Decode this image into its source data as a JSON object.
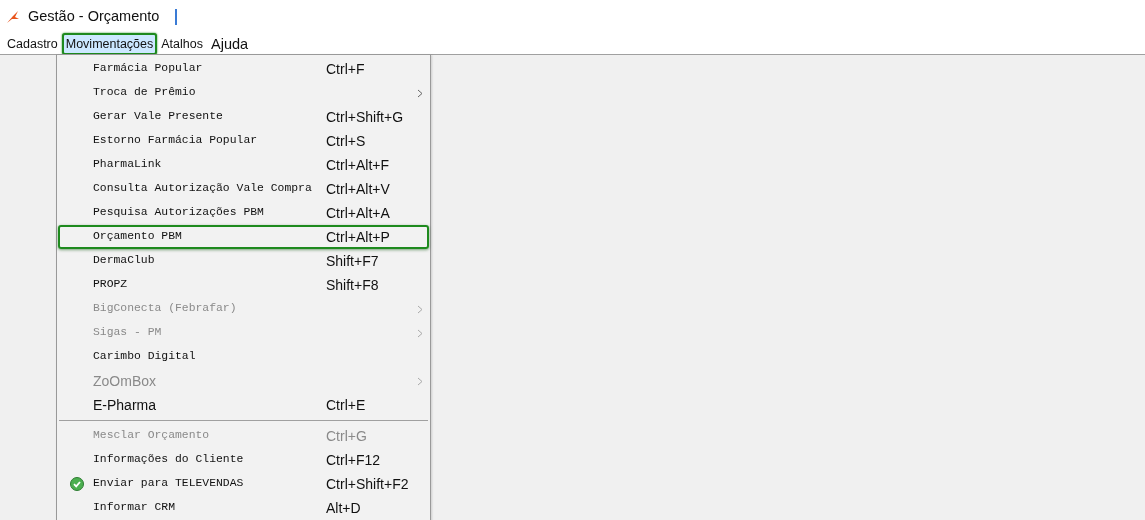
{
  "window": {
    "title": "Gestão - Orçamento"
  },
  "menu_bar": [
    {
      "label": "Cadastro",
      "selected": false
    },
    {
      "label": "Movimentações",
      "selected": true
    },
    {
      "label": "Atalhos",
      "selected": false
    },
    {
      "label": "Ajuda",
      "selected": false
    }
  ],
  "menu": [
    {
      "kind": "mono",
      "label": "Farmácia Popular",
      "shortcut": "Ctrl+F",
      "disabled": false,
      "submenu": false,
      "checked": false,
      "selected": false
    },
    {
      "kind": "mono",
      "label": "Troca de Prêmio",
      "disabled": false,
      "submenu": true,
      "checked": false,
      "selected": false
    },
    {
      "kind": "mono",
      "label": "Gerar Vale Presente",
      "shortcut": "Ctrl+Shift+G",
      "disabled": false,
      "submenu": false,
      "checked": false,
      "selected": false
    },
    {
      "kind": "mono",
      "label": "Estorno Farmácia Popular",
      "shortcut": "Ctrl+S",
      "disabled": false,
      "submenu": false,
      "checked": false,
      "selected": false
    },
    {
      "kind": "mono",
      "label": "PharmaLink",
      "shortcut": "Ctrl+Alt+F",
      "disabled": false,
      "submenu": false,
      "checked": false,
      "selected": false
    },
    {
      "kind": "mono",
      "label": "Consulta Autorização Vale Compra",
      "shortcut": "Ctrl+Alt+V",
      "disabled": false,
      "submenu": false,
      "checked": false,
      "selected": false
    },
    {
      "kind": "mono",
      "label": "Pesquisa Autorizações PBM",
      "shortcut": "Ctrl+Alt+A",
      "disabled": false,
      "submenu": false,
      "checked": false,
      "selected": false
    },
    {
      "kind": "mono",
      "label": "Orçamento PBM",
      "shortcut": "Ctrl+Alt+P",
      "disabled": false,
      "submenu": false,
      "checked": false,
      "selected": true
    },
    {
      "kind": "mono",
      "label": "DermaClub",
      "shortcut": "Shift+F7",
      "disabled": false,
      "submenu": false,
      "checked": false,
      "selected": false
    },
    {
      "kind": "mono",
      "label": "PROPZ",
      "shortcut": "Shift+F8",
      "disabled": false,
      "submenu": false,
      "checked": false,
      "selected": false
    },
    {
      "kind": "mono",
      "label": "BigConecta (Febrafar)",
      "disabled": true,
      "submenu": true,
      "checked": false,
      "selected": false
    },
    {
      "kind": "mono",
      "label": "Sigas - PM",
      "disabled": true,
      "submenu": true,
      "checked": false,
      "selected": false
    },
    {
      "kind": "mono",
      "label": "Carimbo Digital",
      "disabled": false,
      "submenu": false,
      "checked": false,
      "selected": false
    },
    {
      "kind": "sans",
      "label": "ZoOmBox",
      "disabled": true,
      "submenu": true,
      "checked": false,
      "selected": false
    },
    {
      "kind": "sans",
      "label": "E-Pharma",
      "shortcut": "Ctrl+E",
      "disabled": false,
      "submenu": false,
      "checked": false,
      "selected": false
    },
    {
      "kind": "separator"
    },
    {
      "kind": "mono",
      "label": "Mesclar Orçamento",
      "shortcut": "Ctrl+G",
      "disabled": true,
      "submenu": false,
      "checked": false,
      "selected": false
    },
    {
      "kind": "mono",
      "label": "Informações do Cliente",
      "shortcut": "Ctrl+F12",
      "disabled": false,
      "submenu": false,
      "checked": false,
      "selected": false
    },
    {
      "kind": "mono",
      "label": "Enviar para TELEVENDAS",
      "shortcut": "Ctrl+Shift+F2",
      "disabled": false,
      "submenu": false,
      "checked": true,
      "selected": false
    },
    {
      "kind": "mono",
      "label": "Informar CRM",
      "shortcut": "Alt+D",
      "disabled": false,
      "submenu": false,
      "checked": false,
      "selected": false
    }
  ]
}
